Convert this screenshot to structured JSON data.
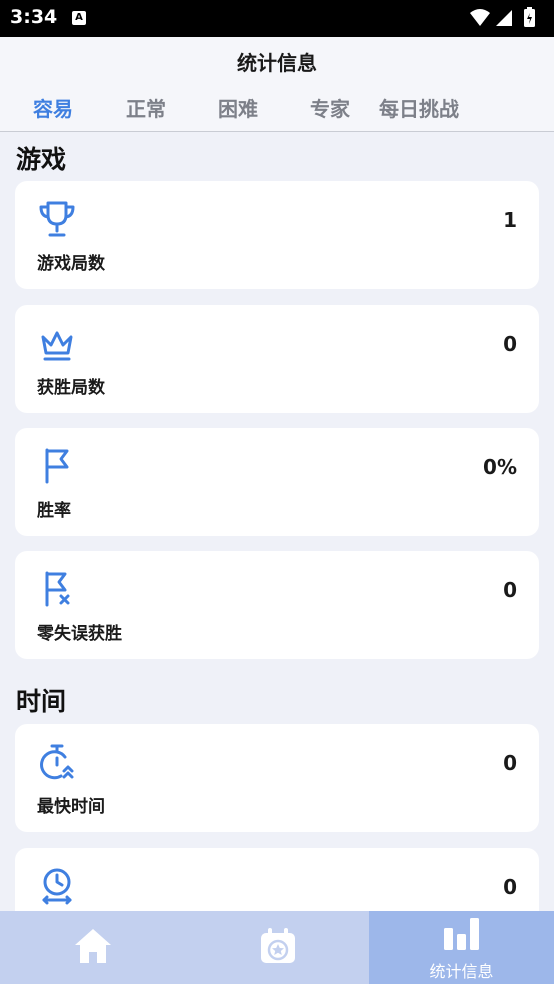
{
  "status_bar": {
    "time": "3:34",
    "notif_letter": "A"
  },
  "header": {
    "title": "统计信息",
    "tabs": [
      {
        "label": "容易",
        "active": true
      },
      {
        "label": "正常",
        "active": false
      },
      {
        "label": "困难",
        "active": false
      },
      {
        "label": "专家",
        "active": false
      },
      {
        "label": "每日挑战",
        "active": false
      }
    ]
  },
  "sections": {
    "game": {
      "title": "游戏",
      "cards": [
        {
          "icon": "trophy-icon",
          "label": "游戏局数",
          "value": "1"
        },
        {
          "icon": "crown-icon",
          "label": "获胜局数",
          "value": "0"
        },
        {
          "icon": "flag-icon",
          "label": "胜率",
          "value": "0%"
        },
        {
          "icon": "flag-x-icon",
          "label": "零失误获胜",
          "value": "0"
        }
      ]
    },
    "time": {
      "title": "时间",
      "cards": [
        {
          "icon": "timer-fast-icon",
          "label": "最快时间",
          "value": "0"
        },
        {
          "icon": "clock-average-icon",
          "label": "",
          "value": "0"
        }
      ]
    }
  },
  "bottom_nav": {
    "items": [
      {
        "icon": "home-icon",
        "label": "",
        "active": false
      },
      {
        "icon": "calendar-star-icon",
        "label": "",
        "active": false
      },
      {
        "icon": "bar-chart-icon",
        "label": "统计信息",
        "active": true
      }
    ]
  },
  "colors": {
    "accent": "#3f7fe0",
    "nav_bg": "#c3d0ef",
    "nav_active": "#9db7ea"
  }
}
